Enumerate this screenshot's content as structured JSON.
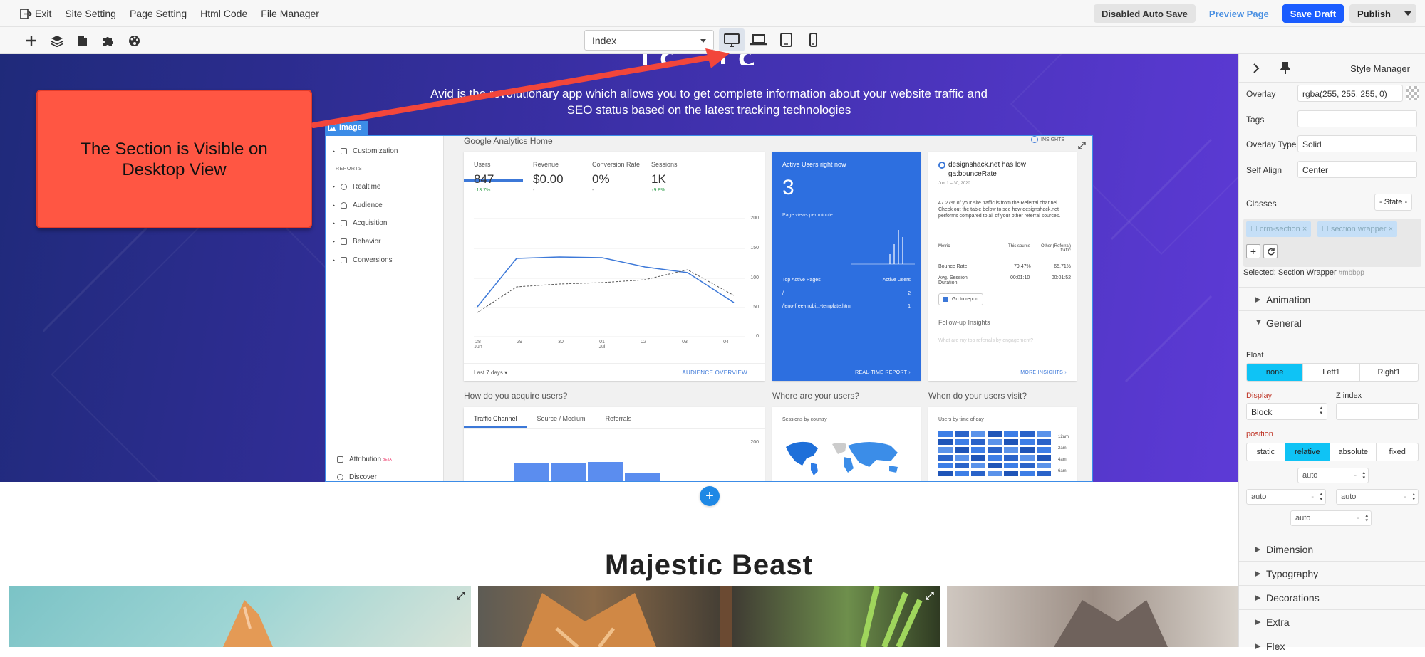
{
  "topbar": {
    "menu": [
      "Exit",
      "Site Setting",
      "Page Setting",
      "Html Code",
      "File Manager"
    ],
    "disabled_autosave": "Disabled Auto Save",
    "preview": "Preview Page",
    "save_draft": "Save Draft",
    "publish": "Publish"
  },
  "toolbar": {
    "page_select": "Index",
    "active_device": "desktop"
  },
  "hero": {
    "text": "Avid is the revolutionary app which allows you to get complete information about your website traffic and SEO status based on the latest tracking technologies",
    "callout": "The Section is Visible on Desktop View",
    "image_tag": "Image"
  },
  "ga": {
    "sidebar": {
      "customization": "Customization",
      "reports_header": "REPORTS",
      "items": [
        "Realtime",
        "Audience",
        "Acquisition",
        "Behavior",
        "Conversions"
      ],
      "attribution": "Attribution",
      "attribution_badge": "BETA",
      "discover": "Discover"
    },
    "home_title": "Google Analytics Home",
    "insights_label": "INSIGHTS",
    "metrics": [
      {
        "label": "Users",
        "value": "847",
        "delta": "↑13.7%"
      },
      {
        "label": "Revenue",
        "value": "$0.00",
        "delta": "-"
      },
      {
        "label": "Conversion Rate",
        "value": "0%",
        "delta": "-"
      },
      {
        "label": "Sessions",
        "value": "1K",
        "delta": "↑9.8%"
      }
    ],
    "y_ticks": [
      "200",
      "150",
      "100",
      "50",
      "0"
    ],
    "x_ticks": [
      "28\nJun",
      "29",
      "30",
      "01\nJul",
      "02",
      "03",
      "04"
    ],
    "chart_footer_left": "Last 7 days",
    "chart_footer_right": "AUDIENCE OVERVIEW",
    "active": {
      "title": "Active Users right now",
      "value": "3",
      "sub": "Page views per minute",
      "pages_header": "Top Active Pages",
      "users_header": "Active Users",
      "rows": [
        {
          "page": "/",
          "users": "2"
        },
        {
          "page": "/leno-free-mobi...-template.html",
          "users": "1"
        }
      ],
      "footer": "REAL-TIME REPORT"
    },
    "insight": {
      "title": "designshack.net has low ga:bounceRate",
      "date": "Jun 1 – 30, 2020",
      "body": "47.27% of your site traffic is from the Referral channel. Check out the table below to see how designshack.net performs compared to all of your other referral sources.",
      "col_metric": "Metric",
      "col_this": "This source",
      "col_other": "Other (Referral) traffic",
      "rows": [
        {
          "metric": "Bounce Rate",
          "this": "79.47%",
          "other": "65.71%"
        },
        {
          "metric": "Avg. Session Duration",
          "this": "00:01:10",
          "other": "00:01:52"
        }
      ],
      "button": "Go to report",
      "followup": "Follow-up Insights",
      "faded": "What are my top referrals by engagement?",
      "footer": "MORE INSIGHTS"
    },
    "acquire": {
      "title": "How do you acquire users?",
      "tabs": [
        "Traffic Channel",
        "Source / Medium",
        "Referrals"
      ],
      "y_top": "200"
    },
    "where": {
      "title": "Where are your users?",
      "sub": "Sessions by country"
    },
    "when": {
      "title": "When do your users visit?",
      "sub": "Users by time of day",
      "times": [
        "12am",
        "2am",
        "4am",
        "6am"
      ]
    }
  },
  "section2": {
    "title": "Majestic Beast"
  },
  "panel": {
    "title": "Style Manager",
    "overlay_label": "Overlay",
    "overlay_value": "rgba(255, 255, 255, 0)",
    "tags_label": "Tags",
    "overlay_type_label": "Overlay Type",
    "overlay_type_value": "Solid",
    "self_align_label": "Self Align",
    "self_align_value": "Center",
    "classes_label": "Classes",
    "state_label": "- State -",
    "classes": [
      "crm-section",
      "section wrapper"
    ],
    "selected": "Selected: Section Wrapper",
    "selected_id": "#mbbpp",
    "sections_top": [
      "Animation",
      "General"
    ],
    "float_label": "Float",
    "float_options": [
      "none",
      "Left1",
      "Right1"
    ],
    "display_label": "Display",
    "display_value": "Block",
    "zindex_label": "Z index",
    "position_label": "position",
    "position_options": [
      "static",
      "relative",
      "absolute",
      "fixed"
    ],
    "auto": "auto",
    "sections_bottom": [
      "Dimension",
      "Typography",
      "Decorations",
      "Extra",
      "Flex"
    ]
  },
  "colors": {
    "accent": "#1a5cff",
    "callout": "#ff5643",
    "toggle_on": "#0fc3f5",
    "hero_start": "#1f2a7a",
    "hero_end": "#5d3ad6"
  }
}
